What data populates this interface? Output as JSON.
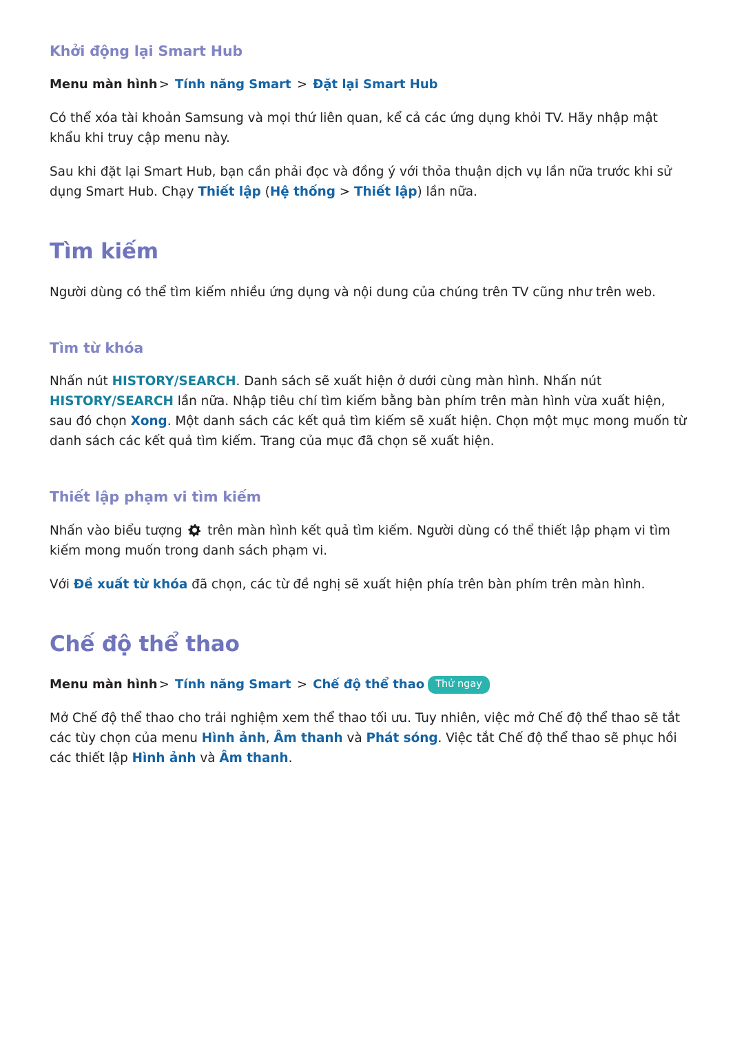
{
  "colors": {
    "heading_h2": "#6f74bd",
    "heading_h3": "#8084c4",
    "menu_link": "#1464a5",
    "keyword_teal": "#16809e",
    "body_text": "#231f20",
    "badge_bg": "#2bb3ae",
    "badge_text": "#ffffff"
  },
  "sections": {
    "smart_hub_reset": {
      "heading": "Khởi động lại Smart Hub",
      "path": {
        "root": "Menu màn hình",
        "sep1": ">",
        "item1": "Tính năng Smart",
        "sep2": ">",
        "item2": "Đặt lại Smart Hub"
      },
      "paragraph_1": "Có thể xóa tài khoản Samsung và mọi thứ liên quan, kể cả các ứng dụng khỏi TV. Hãy nhập mật khẩu khi truy cập menu này.",
      "paragraph_2": {
        "t1": "Sau khi đặt lại Smart Hub, bạn cần phải đọc và đồng ý với thỏa thuận dịch vụ lần nữa trước khi sử dụng Smart Hub. Chạy ",
        "b1": "Thiết lập",
        "t2": " (",
        "b2": "Hệ thống",
        "t3": " > ",
        "b3": "Thiết lập",
        "t4": ") lần nữa."
      }
    },
    "search": {
      "heading": "Tìm kiếm",
      "intro": "Người dùng có thể tìm kiếm nhiều ứng dụng và nội dung của chúng trên TV cũng như trên web.",
      "keyword_search": {
        "heading": "Tìm từ khóa",
        "paragraph": {
          "t1": "Nhấn nút ",
          "b1": "HISTORY/SEARCH",
          "t2": ". Danh sách sẽ xuất hiện ở dưới cùng màn hình. Nhấn nút ",
          "b2": "HISTORY/SEARCH",
          "t3": " lần nữa. Nhập tiêu chí tìm kiếm bằng bàn phím trên màn hình vừa xuất hiện, sau đó chọn ",
          "b3": "Xong",
          "t4": ". Một danh sách các kết quả tìm kiếm sẽ xuất hiện. Chọn một mục mong muốn từ danh sách các kết quả tìm kiếm. Trang của mục đã chọn sẽ xuất hiện."
        }
      },
      "scope_setting": {
        "heading": "Thiết lập phạm vi tìm kiếm",
        "paragraph_1": {
          "t1": "Nhấn vào biểu tượng ",
          "icon": "gear-icon",
          "t2": " trên màn hình kết quả tìm kiếm. Người dùng có thể thiết lập phạm vi tìm kiếm mong muốn trong danh sách phạm vi."
        },
        "paragraph_2": {
          "t1": "Với ",
          "b1": "Đề xuất từ khóa",
          "t2": " đã chọn, các từ đề nghị sẽ xuất hiện phía trên bàn phím trên màn hình."
        }
      }
    },
    "sports_mode": {
      "heading": "Chế độ thể thao",
      "path": {
        "root": "Menu màn hình",
        "sep1": ">",
        "item1": "Tính năng Smart",
        "sep2": ">",
        "item2": "Chế độ thể thao",
        "badge": "Thử ngay"
      },
      "paragraph": {
        "t1": "Mở Chế độ thể thao cho trải nghiệm xem thể thao tối ưu. Tuy nhiên, việc mở Chế độ thể thao sẽ tắt các tùy chọn của menu ",
        "b1": "Hình ảnh",
        "t2": ", ",
        "b2": "Âm thanh",
        "t3": " và ",
        "b3": "Phát sóng",
        "t4": ". Việc tắt Chế độ thể thao sẽ phục hồi các thiết lập ",
        "b4": "Hình ảnh",
        "t5": " và ",
        "b5": "Âm thanh",
        "t6": "."
      }
    }
  }
}
